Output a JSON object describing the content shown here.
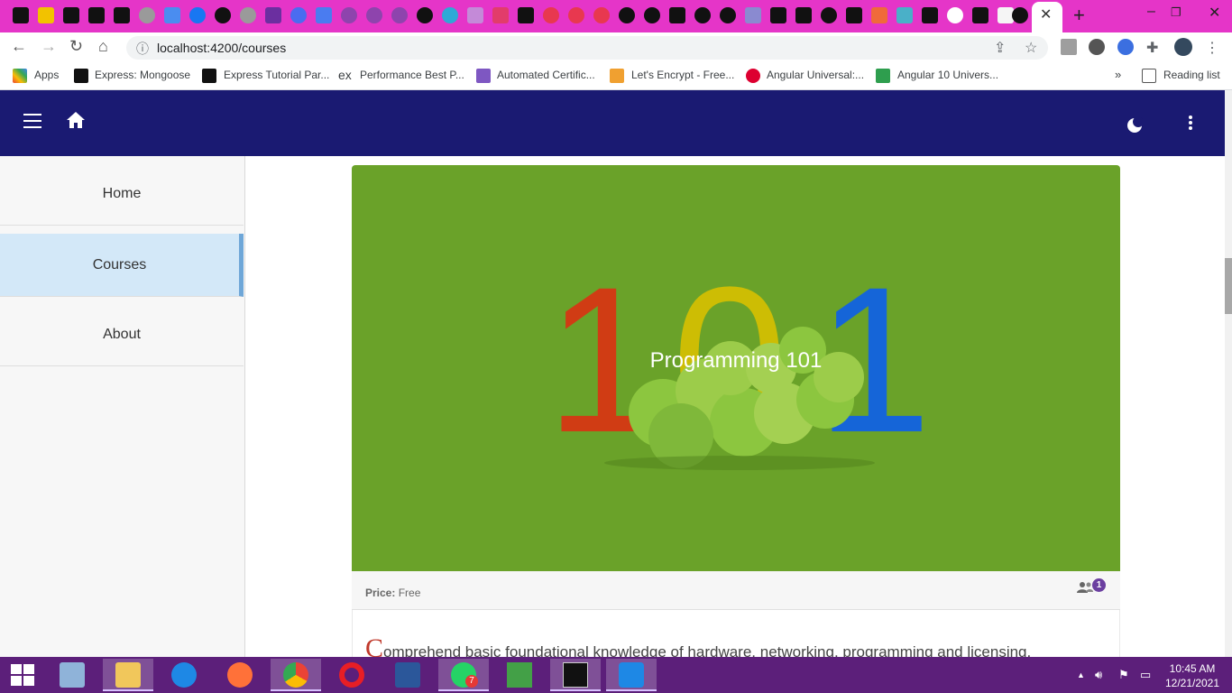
{
  "browser": {
    "url": "localhost:4200/courses",
    "bookmarks": [
      "Apps",
      "Express: Mongoose",
      "Express Tutorial Par...",
      "Performance Best P...",
      "Automated Certific...",
      "Let's Encrypt - Free...",
      "Angular Universal:...",
      "Angular 10 Univers..."
    ],
    "overflow": "»",
    "reading_list": "Reading list"
  },
  "sidenav": {
    "items": [
      {
        "label": "Home",
        "active": false
      },
      {
        "label": "Courses",
        "active": true
      },
      {
        "label": "About",
        "active": false
      }
    ]
  },
  "course": {
    "image_text_digits": [
      "1",
      "0",
      "1"
    ],
    "title": "Programming 101",
    "price_label": "Price:",
    "price_value": "Free",
    "enrolled_count": "1",
    "description_dropcap": "C",
    "description_rest": "omprehend basic foundational knowledge of hardware, networking, programming and licensing."
  },
  "taskbar": {
    "time": "10:45 AM",
    "date": "12/21/2021",
    "whatsapp_badge": "7"
  },
  "colors": {
    "appbar": "#1a1a72",
    "card_image_bg": "#6aa229",
    "sidenav_active": "#d3e8f8",
    "badge": "#6b3fa0",
    "taskbar": "#5c1f7a"
  },
  "icons": [
    "menu-icon",
    "home-icon",
    "moon-icon",
    "more-vert-icon",
    "group-icon"
  ]
}
